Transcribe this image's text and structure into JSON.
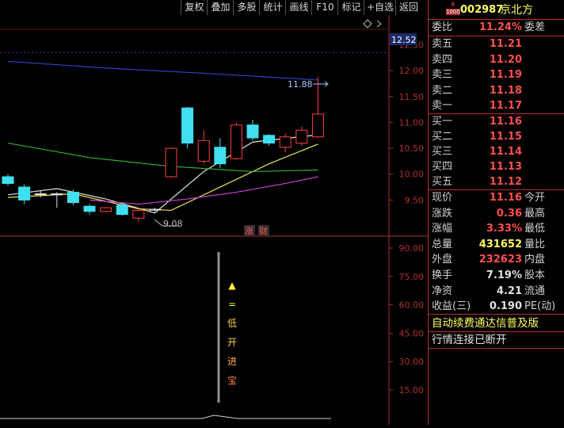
{
  "toolbar": {
    "buttons": [
      "复权",
      "叠加",
      "多股",
      "统计",
      "画线",
      "F10",
      "标记",
      "+自选",
      "返回"
    ]
  },
  "header": {
    "badge_top": "R",
    "badge_bottom": "1000",
    "code": "002987",
    "name": "京北方"
  },
  "quote": {
    "weibi_label": "委比",
    "weibi_value": "11.24%",
    "weicha_label": "委差",
    "sell": [
      {
        "label": "卖五",
        "price": "11.21"
      },
      {
        "label": "卖四",
        "price": "11.20"
      },
      {
        "label": "卖三",
        "price": "11.19"
      },
      {
        "label": "卖二",
        "price": "11.18"
      },
      {
        "label": "卖一",
        "price": "11.17"
      }
    ],
    "buy": [
      {
        "label": "买一",
        "price": "11.16"
      },
      {
        "label": "买二",
        "price": "11.15"
      },
      {
        "label": "买三",
        "price": "11.14"
      },
      {
        "label": "买四",
        "price": "11.13"
      },
      {
        "label": "买五",
        "price": "11.12"
      }
    ],
    "stats": [
      {
        "label": "现价",
        "value": "11.16",
        "label2": "今开",
        "color": "#ff5050"
      },
      {
        "label": "涨跌",
        "value": "0.36",
        "label2": "最高",
        "color": "#ff5050"
      },
      {
        "label": "涨幅",
        "value": "3.33%",
        "label2": "最低",
        "color": "#ff5050"
      },
      {
        "label": "总量",
        "value": "431652",
        "label2": "量比",
        "color": "#ffff60"
      },
      {
        "label": "外盘",
        "value": "232623",
        "label2": "内盘",
        "color": "#ff5050"
      },
      {
        "label": "换手",
        "value": "7.19%",
        "label2": "股本",
        "color": "#e0e0e0"
      },
      {
        "label": "净资",
        "value": "4.21",
        "label2": "流通",
        "color": "#e0e0e0"
      },
      {
        "label": "收益(三)",
        "value": "0.190",
        "label2": "PE(动)",
        "color": "#e0e0e0"
      }
    ],
    "promo": "自动续费通达信普及版",
    "status": "行情连接已断开"
  },
  "chart": {
    "price_tag": "12.52",
    "high_label": "11.88",
    "low_label": "9.08",
    "price_axis": [
      "12.50",
      "12.00",
      "11.50",
      "11.00",
      "10.50",
      "10.00",
      "9.50"
    ],
    "badge_zhang": "涨",
    "badge_cai": "财",
    "indicator_axis": [
      "90.00",
      "75.00",
      "60.00",
      "45.00",
      "30.00",
      "15.00"
    ],
    "indicator_text": [
      "▲",
      "=",
      "低",
      "开",
      "进",
      "宝"
    ]
  },
  "chart_data": {
    "type": "candlestick",
    "candles": [
      {
        "o": 9.95,
        "c": 9.82,
        "h": 10.0,
        "l": 9.78,
        "dir": "down"
      },
      {
        "o": 9.75,
        "c": 9.5,
        "h": 9.8,
        "l": 9.42,
        "dir": "down"
      },
      {
        "o": 9.62,
        "c": 9.62,
        "h": 9.68,
        "l": 9.55,
        "dir": "flat"
      },
      {
        "o": 9.6,
        "c": 9.62,
        "h": 9.65,
        "l": 9.35,
        "dir": "flat"
      },
      {
        "o": 9.65,
        "c": 9.45,
        "h": 9.7,
        "l": 9.4,
        "dir": "down"
      },
      {
        "o": 9.38,
        "c": 9.28,
        "h": 9.42,
        "l": 9.22,
        "dir": "down"
      },
      {
        "o": 9.28,
        "c": 9.35,
        "h": 9.37,
        "l": 9.26,
        "dir": "up"
      },
      {
        "o": 9.4,
        "c": 9.22,
        "h": 9.45,
        "l": 9.2,
        "dir": "down"
      },
      {
        "o": 9.15,
        "c": 9.3,
        "h": 9.35,
        "l": 9.08,
        "dir": "up"
      },
      {
        "o": 9.32,
        "c": 9.32,
        "h": 9.35,
        "l": 9.28,
        "dir": "flat"
      },
      {
        "o": 9.95,
        "c": 10.5,
        "h": 10.52,
        "l": 9.93,
        "dir": "up"
      },
      {
        "o": 11.28,
        "c": 10.6,
        "h": 11.3,
        "l": 10.5,
        "dir": "down"
      },
      {
        "o": 10.25,
        "c": 10.65,
        "h": 10.85,
        "l": 10.2,
        "dir": "up"
      },
      {
        "o": 10.52,
        "c": 10.2,
        "h": 10.7,
        "l": 10.12,
        "dir": "down"
      },
      {
        "o": 10.3,
        "c": 10.95,
        "h": 11.0,
        "l": 10.28,
        "dir": "up"
      },
      {
        "o": 10.95,
        "c": 10.7,
        "h": 11.05,
        "l": 10.65,
        "dir": "down"
      },
      {
        "o": 10.75,
        "c": 10.6,
        "h": 10.78,
        "l": 10.55,
        "dir": "down"
      },
      {
        "o": 10.52,
        "c": 10.72,
        "h": 10.78,
        "l": 10.42,
        "dir": "up"
      },
      {
        "o": 10.6,
        "c": 10.85,
        "h": 10.92,
        "l": 10.55,
        "dir": "up"
      },
      {
        "o": 10.72,
        "c": 11.16,
        "h": 11.88,
        "l": 10.7,
        "dir": "up"
      }
    ],
    "ma_blue": [
      [
        0,
        12.18
      ],
      [
        6,
        12.05
      ],
      [
        12,
        11.95
      ],
      [
        19,
        11.82
      ]
    ],
    "ma_white": [
      [
        0,
        9.6
      ],
      [
        3,
        9.72
      ],
      [
        6,
        9.52
      ],
      [
        9,
        9.25
      ],
      [
        12,
        10.05
      ],
      [
        15,
        10.62
      ],
      [
        19,
        10.76
      ]
    ],
    "ma_yellow": [
      [
        0,
        9.55
      ],
      [
        4,
        9.62
      ],
      [
        8,
        9.33
      ],
      [
        10,
        9.3
      ],
      [
        13,
        9.75
      ],
      [
        16,
        10.2
      ],
      [
        19,
        10.58
      ]
    ],
    "ma_green": [
      [
        0,
        10.6
      ],
      [
        5,
        10.32
      ],
      [
        10,
        10.15
      ],
      [
        15,
        10.05
      ],
      [
        19,
        10.08
      ]
    ],
    "ma_magenta": [
      [
        5,
        9.5
      ],
      [
        8,
        9.42
      ],
      [
        11,
        9.52
      ],
      [
        14,
        9.65
      ],
      [
        17,
        9.82
      ],
      [
        19,
        9.95
      ]
    ],
    "ylim": [
      9.0,
      12.6
    ]
  }
}
